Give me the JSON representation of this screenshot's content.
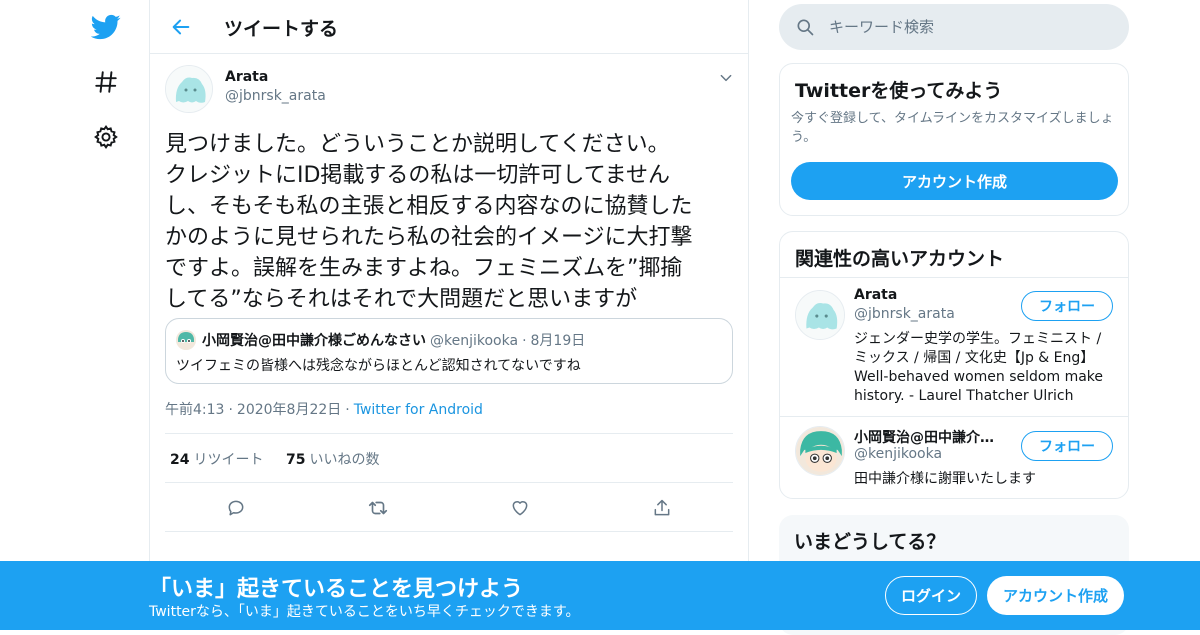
{
  "colors": {
    "accent": "#1da1f2",
    "text": "#14171a",
    "secondary": "#657786",
    "border": "#e6ecf0"
  },
  "icons": {
    "logo": "twitter-bird-icon",
    "explore": "hashtag-icon",
    "settings": "gear-icon",
    "back": "arrow-left-icon",
    "caret": "chevron-down-icon",
    "search": "search-icon",
    "reply": "reply-icon",
    "retweet": "retweet-icon",
    "like": "heart-icon",
    "share": "share-icon"
  },
  "header": {
    "title": "ツイートする"
  },
  "tweet": {
    "author_name": "Arata",
    "author_handle": "@jbnrsk_arata",
    "text": "見つけました。どういうことか説明してください。\nクレジットにID掲載するの私は一切許可してません\nし、そもそも私の主張と相反する内容なのに協賛した\nかのように見せられたら私の社会的イメージに大打撃\nですよ。誤解を生みますよね。フェミニズムを”揶揄\nしてる”ならそれはそれで大問題だと思いますが",
    "quote": {
      "name": "小岡賢治@田中謙介様ごめんなさい",
      "handle": "@kenjikooka",
      "dot": "·",
      "date": "8月19日",
      "text": "ツイフェミの皆様へは残念ながらほとんど認知されてないですね"
    },
    "time": "午前4:13",
    "date": "2020年8月22日",
    "separator": "·",
    "source": "Twitter for Android",
    "retweet_count": "24",
    "retweet_label": "リツイート",
    "like_count": "75",
    "like_label": "いいねの数"
  },
  "search": {
    "placeholder": "キーワード検索"
  },
  "signup_card": {
    "title": "Twitterを使ってみよう",
    "description": "今すぐ登録して、タイムラインをカスタマイズしましょう。",
    "button": "アカウント作成"
  },
  "related": {
    "title": "関連性の高いアカウント",
    "accounts": [
      {
        "name": "Arata",
        "handle": "@jbnrsk_arata",
        "bio": "ジェンダー史学の学生。フェミニスト / ミックス / 帰国 / 文化史【Jp & Eng】Well-behaved women seldom make history. - Laurel Thatcher Ulrich",
        "follow": "フォロー"
      },
      {
        "name": "小岡賢治@田中謙介…",
        "handle": "@kenjikooka",
        "bio": "田中謙介様に謝罪いたします",
        "follow": "フォロー"
      }
    ]
  },
  "trends": {
    "title": "いまどうしてる？"
  },
  "banner": {
    "title": "「いま」起きていることを見つけよう",
    "subtitle": "Twitterなら、「いま」起きていることをいち早くチェックできます。",
    "login": "ログイン",
    "signup": "アカウント作成"
  }
}
